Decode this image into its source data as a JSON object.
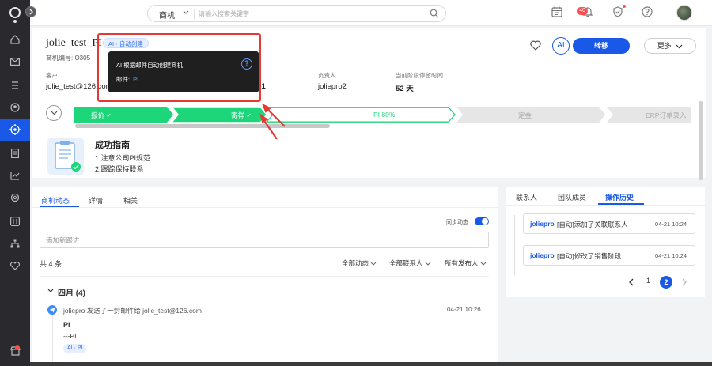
{
  "search": {
    "type": "商机",
    "placeholder": "请输入搜索关键字"
  },
  "topbar": {
    "notification_count": "40"
  },
  "opportunity": {
    "title": "jolie_test_PI",
    "ai_tag": "AI · 自动创建",
    "number": "商机编号: O305",
    "fields": [
      {
        "label": "客户",
        "value": "jolie_test@126.com"
      },
      {
        "label": "负责人",
        "value": "joliepro2"
      },
      {
        "label": "当前阶段停留时间",
        "value": "52 天"
      }
    ],
    "partial_value": "-21"
  },
  "actions": {
    "ai": "AI",
    "transfer": "转移",
    "more": "更多"
  },
  "tooltip": {
    "line1": "AI 根据邮件自动创建商机",
    "mail_label": "邮件:",
    "mail_value": "PI",
    "help": "?"
  },
  "stages": [
    {
      "label": "报价",
      "status": "done"
    },
    {
      "label": "寄样",
      "status": "done"
    },
    {
      "label": "PI 80%",
      "status": "current"
    },
    {
      "label": "定金",
      "status": "todo"
    },
    {
      "label": "ERP订单录入",
      "status": "todo"
    }
  ],
  "guide": {
    "title": "成功指南",
    "items": [
      "1.注意公司PI规范",
      "2.跟踪保持联系"
    ]
  },
  "left_tabs": [
    "商机动态",
    "详情",
    "相关"
  ],
  "feed": {
    "sync_label": "同步动态",
    "input_placeholder": "添加新跟进",
    "count": "共 4 条",
    "filters": [
      "全部动态",
      "全部联系人",
      "所有发布人"
    ],
    "month": "四月 (4)",
    "entry": {
      "text": "joliepro 发送了一封邮件给 jolie_test@126.com",
      "time": "04-21 10:26",
      "subject": "PI",
      "body": "---PI",
      "tags": "AI · PI"
    }
  },
  "right_tabs": [
    "联系人",
    "团队成员",
    "操作历史"
  ],
  "history": [
    {
      "user": "joliepro",
      "text": "[自动]添加了关联联系人",
      "time": "04-21 10:24"
    },
    {
      "user": "joliepro",
      "text": "[自动]修改了销售阶段",
      "time": "04-21 10:24"
    }
  ],
  "pager": {
    "page1": "1",
    "current": "2"
  },
  "colors": {
    "primary": "#1a58e8",
    "stage_done": "#1ed67a",
    "annotation": "#e53935"
  }
}
